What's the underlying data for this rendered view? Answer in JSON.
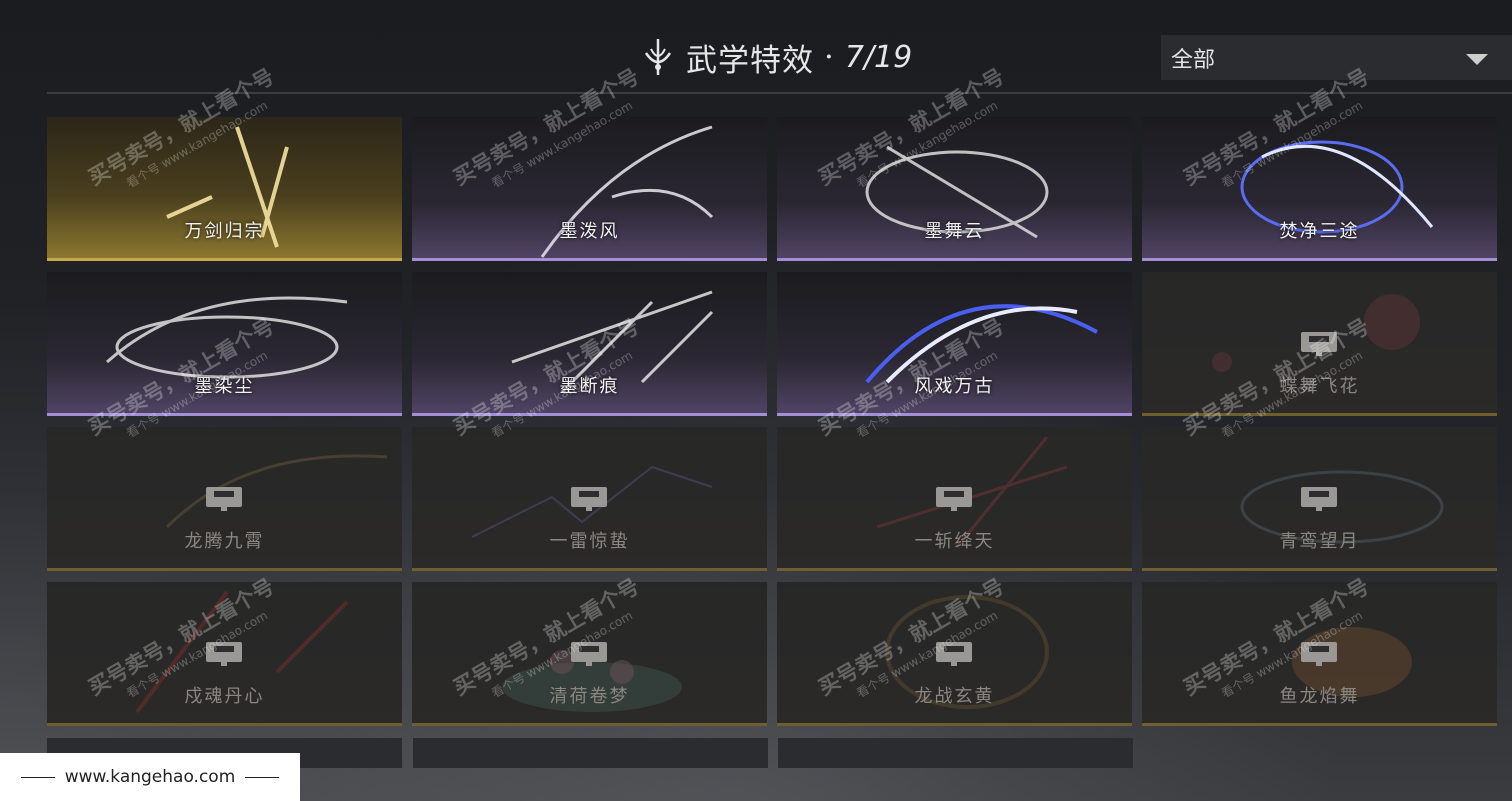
{
  "header": {
    "title": "武学特效",
    "separator": "·",
    "count": "7/19",
    "filter": {
      "selected": "全部"
    }
  },
  "cards": [
    {
      "name": "万剑归宗",
      "state": "unlocked",
      "tier": "gold"
    },
    {
      "name": "墨泼风",
      "state": "unlocked",
      "tier": "purple"
    },
    {
      "name": "墨舞云",
      "state": "unlocked",
      "tier": "purple"
    },
    {
      "name": "焚净三途",
      "state": "unlocked",
      "tier": "purple"
    },
    {
      "name": "墨染尘",
      "state": "unlocked",
      "tier": "purple"
    },
    {
      "name": "墨断痕",
      "state": "unlocked",
      "tier": "purple"
    },
    {
      "name": "风戏万古",
      "state": "unlocked",
      "tier": "purple"
    },
    {
      "name": "蝶舞飞花",
      "state": "locked",
      "tier": "gold"
    },
    {
      "name": "龙腾九霄",
      "state": "locked",
      "tier": "gold"
    },
    {
      "name": "一雷惊蛰",
      "state": "locked",
      "tier": "gold"
    },
    {
      "name": "一斩绛天",
      "state": "locked",
      "tier": "gold"
    },
    {
      "name": "青鸾望月",
      "state": "locked",
      "tier": "gold"
    },
    {
      "name": "戍魂丹心",
      "state": "locked",
      "tier": "gold"
    },
    {
      "name": "清荷卷梦",
      "state": "locked",
      "tier": "gold"
    },
    {
      "name": "龙战玄黄",
      "state": "locked",
      "tier": "gold"
    },
    {
      "name": "鱼龙焰舞",
      "state": "locked",
      "tier": "gold"
    }
  ],
  "watermark": {
    "text": "买号卖号，就上看个号",
    "sub": "看个号  www.kangehao.com",
    "footer_url": "www.kangehao.com"
  },
  "colors": {
    "gold": "#c6a64a",
    "purple": "#a48ed6",
    "blue_glow": "#3b4fd8",
    "red_glow": "#d23a3a"
  }
}
